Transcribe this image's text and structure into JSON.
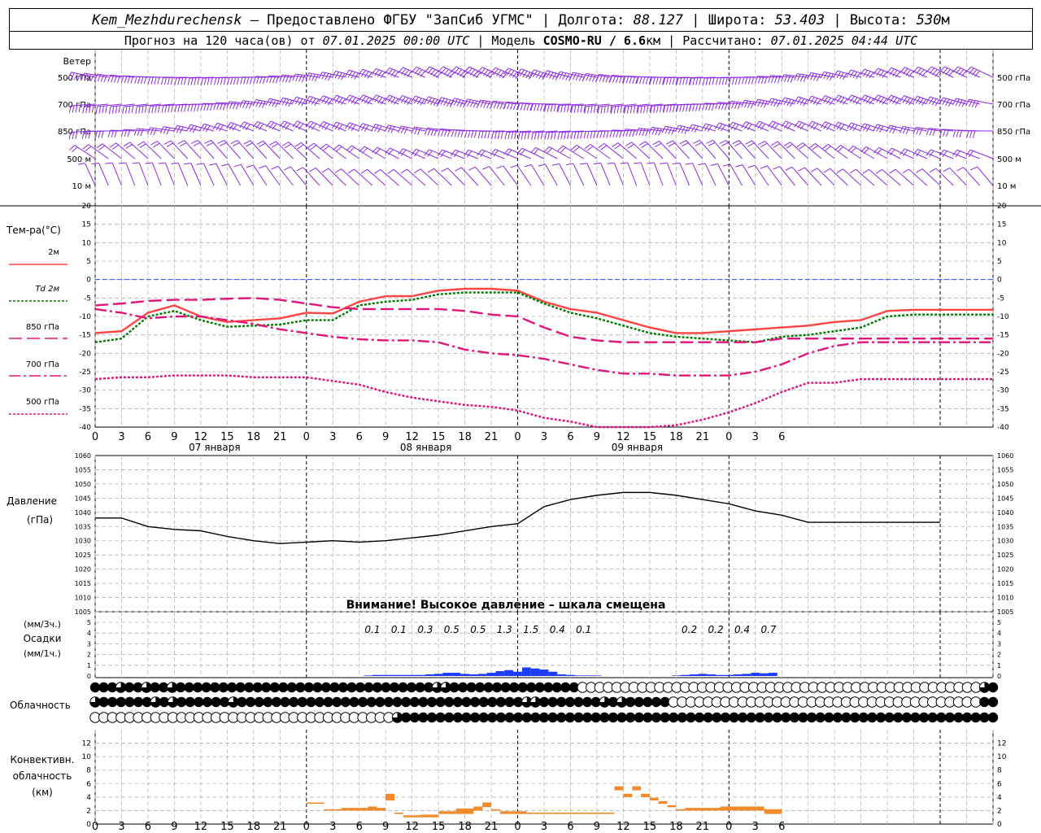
{
  "header": {
    "station": "Kem_Mezhdurechensk",
    "provider": "– Предоставлено ФГБУ \"ЗапСиб УГМС\"",
    "lon_label": "Долгота:",
    "lon": "88.127",
    "lat_label": "Широта:",
    "lat": "53.403",
    "alt_label": "Высота:",
    "alt": "530",
    "alt_unit": "м",
    "forecast_prefix": "Прогноз на 120 часа(ов) от",
    "forecast_start": "07.01.2025 00:00 UTC",
    "model_label": "Модель",
    "model": "COSMO-RU / 6.6",
    "model_unit": "км",
    "computed_label": "Рассчитано:",
    "computed": "07.01.2025 04:44 UTC"
  },
  "wind_panel": {
    "title": "Ветер",
    "levels": [
      "500 гПа",
      "700 гПа",
      "850 гПа",
      "500 м",
      "10 м"
    ],
    "barb_color": "#8a2be2"
  },
  "chart_data": [
    {
      "type": "line",
      "panel": "temperature",
      "title": "Тем-ра(°С)",
      "ylim": [
        -40,
        20
      ],
      "yticks": [
        20,
        15,
        10,
        5,
        0,
        -5,
        -10,
        -15,
        -20,
        -25,
        -30,
        -35,
        -40
      ],
      "x_hours": [
        0,
        3,
        6,
        9,
        12,
        15,
        18,
        21,
        0,
        3,
        6,
        9,
        12,
        15,
        18,
        21,
        0,
        3,
        6,
        9,
        12,
        15,
        18,
        21,
        0,
        3,
        6
      ],
      "day_labels": [
        "07 января",
        "08 января",
        "09 января"
      ],
      "x_unit": "hours since 07.01.2025 00 UTC",
      "series": [
        {
          "name": "2м",
          "color": "#ff4444",
          "dash": "",
          "width": 2.4,
          "x": [
            0,
            3,
            6,
            9,
            12,
            15,
            18,
            21,
            24,
            27,
            30,
            33,
            36,
            39,
            42,
            45,
            48,
            51,
            54,
            57,
            60,
            63,
            66,
            69,
            72,
            75,
            78,
            81,
            84,
            87,
            90,
            93,
            96,
            99,
            102
          ],
          "values": [
            -14.5,
            -14,
            -9,
            -7,
            -10,
            -11.5,
            -11,
            -10.5,
            -9,
            -9.2,
            -6,
            -4.5,
            -4.5,
            -3,
            -2.5,
            -2.5,
            -3,
            -6,
            -8,
            -9,
            -11,
            -13,
            -14.5,
            -14.5,
            -14,
            -13.5,
            -13,
            -12.5,
            -11.5,
            -11,
            -8.5,
            -8.2,
            -8.2,
            -8.2,
            -8.2
          ]
        },
        {
          "name": "Td 2м",
          "color": "#007a00",
          "dash": "3 2",
          "width": 2.4,
          "x": [
            0,
            3,
            6,
            9,
            12,
            15,
            18,
            21,
            24,
            27,
            30,
            33,
            36,
            39,
            42,
            45,
            48,
            51,
            54,
            57,
            60,
            63,
            66,
            69,
            72,
            75,
            78,
            81,
            84,
            87,
            90,
            93,
            96,
            99,
            102
          ],
          "values": [
            -17,
            -16,
            -10,
            -8.5,
            -11,
            -12.8,
            -12.5,
            -12.2,
            -11,
            -11,
            -7,
            -6,
            -5.5,
            -4,
            -3.5,
            -3.5,
            -3.5,
            -6.5,
            -9,
            -10.5,
            -12.5,
            -14.5,
            -15.5,
            -16,
            -16.5,
            -17,
            -15.5,
            -15,
            -14,
            -13,
            -10,
            -9.5,
            -9.5,
            -9.5,
            -9.5
          ]
        },
        {
          "name": "850 гПа",
          "color": "#e0157a",
          "dash": "16 6",
          "width": 2.4,
          "x": [
            0,
            3,
            6,
            9,
            12,
            15,
            18,
            21,
            24,
            27,
            30,
            33,
            36,
            39,
            42,
            45,
            48,
            51,
            54,
            57,
            60,
            63,
            66,
            69,
            72,
            75,
            78,
            81,
            84,
            87,
            90,
            93,
            96,
            99,
            102
          ],
          "values": [
            -7,
            -6.5,
            -5.8,
            -5.5,
            -5.5,
            -5.2,
            -5,
            -5.5,
            -6.5,
            -7.5,
            -8,
            -8,
            -8,
            -8,
            -8.5,
            -9.5,
            -10,
            -13,
            -15.5,
            -16.5,
            -17,
            -17,
            -17,
            -17,
            -17,
            -17,
            -16,
            -16,
            -16,
            -16,
            -16,
            -16,
            -16,
            -16,
            -16
          ]
        },
        {
          "name": "700 гПа",
          "color": "#e0157a",
          "dash": "14 4 3 4",
          "width": 2.4,
          "x": [
            0,
            3,
            6,
            9,
            12,
            15,
            18,
            21,
            24,
            27,
            30,
            33,
            36,
            39,
            42,
            45,
            48,
            51,
            54,
            57,
            60,
            63,
            66,
            69,
            72,
            75,
            78,
            81,
            84,
            87,
            90,
            93,
            96,
            99,
            102
          ],
          "values": [
            -8,
            -9,
            -10.5,
            -10,
            -10,
            -11,
            -12,
            -13.5,
            -14.5,
            -15.5,
            -16.2,
            -16.5,
            -16.5,
            -17,
            -19,
            -20,
            -20.5,
            -21.5,
            -23,
            -24.5,
            -25.5,
            -25.5,
            -26,
            -26,
            -26,
            -25,
            -23,
            -20,
            -18,
            -17,
            -17,
            -17,
            -17,
            -17,
            -17
          ]
        },
        {
          "name": "500 гПа",
          "color": "#e0157a",
          "dash": "3 2",
          "width": 2.4,
          "x": [
            0,
            3,
            6,
            9,
            12,
            15,
            18,
            21,
            24,
            27,
            30,
            33,
            36,
            39,
            42,
            45,
            48,
            51,
            54,
            57,
            60,
            63,
            66,
            69,
            72,
            75,
            78,
            81,
            84,
            87,
            90,
            93,
            96,
            99,
            102
          ],
          "values": [
            -27,
            -26.5,
            -26.5,
            -26,
            -26,
            -26,
            -26.5,
            -26.5,
            -26.5,
            -27.5,
            -28.5,
            -30.5,
            -32,
            -33,
            -34,
            -34.5,
            -35.5,
            -37.5,
            -38.5,
            -40,
            -40.5,
            -41,
            -39.5,
            -38,
            -36,
            -33.5,
            -30.5,
            -28,
            -28,
            -27,
            -27,
            -27,
            -27,
            -27,
            -27
          ]
        }
      ]
    },
    {
      "type": "line",
      "panel": "pressure",
      "title": "Давление",
      "ylabel": "(гПа)",
      "ylim": [
        1005,
        1060
      ],
      "yticks": [
        1060,
        1055,
        1050,
        1045,
        1040,
        1035,
        1030,
        1025,
        1020,
        1015,
        1010,
        1005
      ],
      "warning": "Внимание! Высокое давление – шкала смещена",
      "series": [
        {
          "name": "",
          "color": "#000000",
          "x": [
            0,
            3,
            6,
            9,
            12,
            15,
            18,
            21,
            24,
            27,
            30,
            33,
            36,
            39,
            42,
            45,
            48,
            51,
            54,
            57,
            60,
            63,
            66,
            69,
            72,
            75,
            78,
            81,
            84,
            87,
            90,
            93,
            96
          ],
          "values": [
            1038,
            1038,
            1035,
            1034,
            1033.5,
            1031.5,
            1030,
            1029,
            1029.5,
            1030,
            1029.5,
            1030,
            1031,
            1032,
            1033.5,
            1035,
            1036,
            1042,
            1044.5,
            1046,
            1047,
            1047,
            1046,
            1044.5,
            1043,
            1040.5,
            1039,
            1036.5,
            1036.5,
            1036.5,
            1036.5,
            1036.5,
            1036.5
          ]
        }
      ]
    },
    {
      "type": "bar",
      "panel": "precipitation",
      "title": "Осадки",
      "ylabel_top": "(мм/3ч.)",
      "ylabel_bottom": "(мм/1ч.)",
      "ylim": [
        0,
        5
      ],
      "yticks": [
        5,
        4,
        3,
        2,
        1,
        0
      ],
      "color": "#1c3cff",
      "totals_3h": [
        {
          "x": 31.5,
          "label": "0.1"
        },
        {
          "x": 34.5,
          "label": "0.1"
        },
        {
          "x": 37.5,
          "label": "0.3"
        },
        {
          "x": 40.5,
          "label": "0.5"
        },
        {
          "x": 43.5,
          "label": "0.5"
        },
        {
          "x": 46.5,
          "label": "1.3"
        },
        {
          "x": 49.5,
          "label": "1.5"
        },
        {
          "x": 52.5,
          "label": "0.4"
        },
        {
          "x": 55.5,
          "label": "0.1"
        },
        {
          "x": 67.5,
          "label": "0.2"
        },
        {
          "x": 70.5,
          "label": "0.2"
        },
        {
          "x": 73.5,
          "label": "0.4"
        },
        {
          "x": 76.5,
          "label": "0.7"
        }
      ],
      "hourly_x": [
        31,
        32,
        33,
        34,
        35,
        36,
        37,
        38,
        39,
        40,
        41,
        42,
        43,
        44,
        45,
        46,
        47,
        48,
        49,
        50,
        51,
        52,
        53,
        54,
        55,
        56,
        57,
        66,
        67,
        68,
        69,
        70,
        71,
        72,
        73,
        74,
        75,
        76,
        77
      ],
      "hourly_values": [
        0.05,
        0.1,
        0.1,
        0.1,
        0.1,
        0.1,
        0.1,
        0.15,
        0.2,
        0.3,
        0.3,
        0.2,
        0.15,
        0.2,
        0.3,
        0.45,
        0.55,
        0.4,
        0.8,
        0.7,
        0.6,
        0.4,
        0.15,
        0.1,
        0.05,
        0.05,
        0.05,
        0.05,
        0.1,
        0.15,
        0.2,
        0.15,
        0.1,
        0.1,
        0.15,
        0.2,
        0.3,
        0.25,
        0.3
      ]
    },
    {
      "type": "bar",
      "panel": "convective_clouds",
      "title": "Конвективн.",
      "title2": "облачность",
      "ylabel": "(км)",
      "ylim": [
        0,
        14
      ],
      "yticks": [
        12,
        10,
        8,
        6,
        4,
        2,
        0
      ],
      "color": "#f08a2a",
      "x": [
        24,
        25,
        26,
        27,
        28,
        29,
        30,
        31,
        32,
        33,
        34,
        35,
        36,
        37,
        38,
        39,
        40,
        41,
        42,
        43,
        44,
        45,
        46,
        47,
        48,
        49,
        50,
        51,
        52,
        53,
        54,
        55,
        56,
        57,
        58,
        59,
        60,
        61,
        62,
        63,
        64,
        65,
        66,
        67,
        68,
        69,
        70,
        71,
        72,
        73,
        74,
        75,
        76,
        77
      ],
      "base": [
        3,
        3,
        2,
        2,
        2,
        2,
        2,
        2,
        2,
        3.5,
        1.5,
        1,
        1,
        1,
        1,
        1.5,
        1.5,
        1.5,
        1.5,
        2,
        2.5,
        2,
        1.5,
        1.5,
        1.5,
        1.5,
        1.5,
        1.5,
        1.5,
        1.5,
        1.5,
        1.5,
        1.5,
        1.5,
        1.5,
        5,
        4,
        5,
        4,
        3.5,
        3,
        2.5,
        2,
        2,
        2,
        2,
        2,
        2,
        2,
        2,
        2,
        2,
        1.5,
        1.5
      ],
      "top": [
        3.2,
        3.2,
        2.2,
        2.2,
        2.4,
        2.4,
        2.4,
        2.6,
        2.4,
        4.5,
        1.7,
        1.3,
        1.3,
        1.4,
        1.4,
        1.9,
        1.9,
        2.3,
        2.3,
        2.6,
        3.2,
        2.2,
        1.9,
        1.9,
        1.9,
        1.7,
        1.7,
        1.7,
        1.7,
        1.7,
        1.7,
        1.7,
        1.7,
        1.7,
        1.7,
        5.6,
        4.5,
        5.6,
        4.5,
        3.9,
        3.4,
        2.8,
        2.2,
        2.4,
        2.4,
        2.4,
        2.4,
        2.6,
        2.6,
        2.6,
        2.6,
        2.6,
        2.2,
        2.2
      ]
    }
  ],
  "cloudiness": {
    "title": "Облачность",
    "rows": [
      "FFFHFFHFFHFFFFFFFFFFFFFFFFFFFFFFFFFFFFFFHHFFFFFFFFFFFFFFFEEEEEEEEEEEEEEEEEEEEEEEEEEEEEEEEEEEEEEEEEEEEEEEHF",
      "HFFFFFFHFHFFFFFFHFFFFFFFFFFFFFFFFFFFFFFFFFFFFFFFFFHHFFFFFFFHFHFFFFFEEEEEEEEEEEEEEEEEEEEEEEEEEEEEEEEEEEEFF",
      "EEEEEEEEEEEEEEEEEEEEEEEEEEEEEEEEEEEHFFFFFFFFFFFFFFFFFFFFFFFFFFFFFFFFFFFFFFFFFFFFFFFFFFFFFFFFFFFFFFFFFFFFF"
    ]
  }
}
